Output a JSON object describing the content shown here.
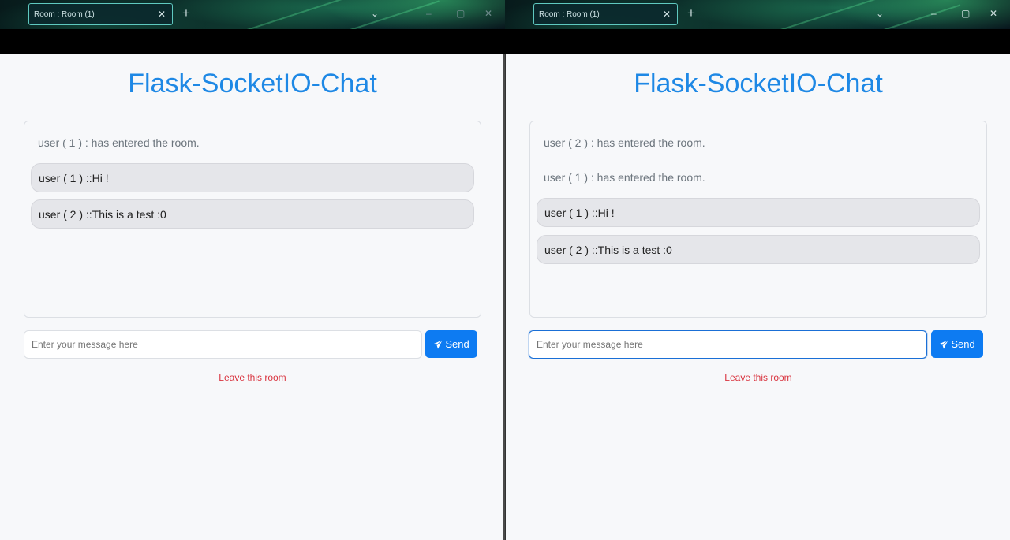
{
  "windows": [
    {
      "tab_title": "Room : Room (1)",
      "page_title": "Flask-SocketIO-Chat",
      "system_messages": [
        "user ( 1 ) : has entered the room."
      ],
      "messages": [
        "user ( 1 ) ::Hi !",
        "user ( 2 ) ::This is a test :0"
      ],
      "input_placeholder": "Enter your message here",
      "send_label": "Send",
      "leave_label": "Leave this room"
    },
    {
      "tab_title": "Room : Room (1)",
      "page_title": "Flask-SocketIO-Chat",
      "system_messages": [
        "user ( 2 ) : has entered the room.",
        "user ( 1 ) : has entered the room."
      ],
      "messages": [
        "user ( 1 ) ::Hi !",
        "user ( 2 ) ::This is a test :0"
      ],
      "input_placeholder": "Enter your message here",
      "send_label": "Send",
      "leave_label": "Leave this room"
    }
  ],
  "colors": {
    "accent": "#1e88e5",
    "send_button": "#0d7bf2",
    "leave_link": "#d9343f",
    "message_bubble": "#e5e6ea"
  },
  "icons": {
    "send": "paper-plane-icon",
    "close": "close-icon",
    "new_tab": "plus-icon"
  }
}
